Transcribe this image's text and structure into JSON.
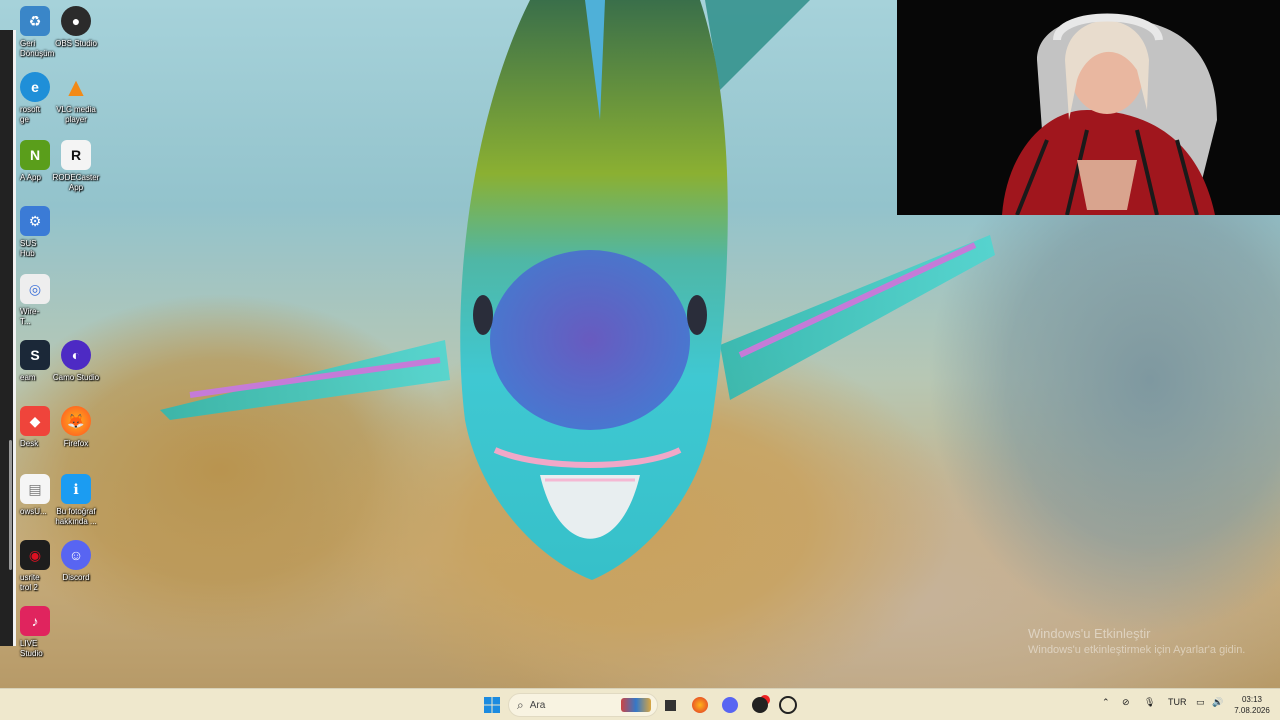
{
  "desktop": {
    "wallpaper": "parrotfish-underwater",
    "icons_col1": [
      {
        "name": "recycle-bin-icon",
        "label": "Geri\nDönüşüm",
        "color": "#3a86c8",
        "glyph": "♻"
      },
      {
        "name": "edge-icon",
        "label": "rosoft\nge",
        "color": "#1f8fd8",
        "glyph": "e"
      },
      {
        "name": "nvidia-icon",
        "label": "A App",
        "color": "#5a9e1b",
        "glyph": "N"
      },
      {
        "name": "asus-icon",
        "label": "SUS\nHub",
        "color": "#3b7bd6",
        "glyph": "⚙"
      },
      {
        "name": "wiretap-icon",
        "label": "Wire-T...",
        "color": "#eeeeee",
        "glyph": "◎"
      },
      {
        "name": "steam-icon",
        "label": "eam",
        "color": "#1b2838",
        "glyph": "S"
      },
      {
        "name": "anydesk-icon",
        "label": "Desk",
        "color": "#ef443b",
        "glyph": "◆"
      },
      {
        "name": "file-icon",
        "label": "owsU...",
        "color": "#f5f5f5",
        "glyph": "▤"
      },
      {
        "name": "focusrite-icon",
        "label": "usrite\ntrol 2",
        "color": "#1d1d1d",
        "glyph": "◉"
      },
      {
        "name": "tiktok-live-icon",
        "label": "LIVE\nStudio",
        "color": "#e0245e",
        "glyph": "♪"
      }
    ],
    "icons_col2": [
      {
        "name": "obs-studio-icon",
        "label": "OBS Studio",
        "color": "#2b2b2b",
        "glyph": "●"
      },
      {
        "name": "vlc-icon",
        "label": "VLC media\nplayer",
        "color": "#f28a17",
        "glyph": "▲"
      },
      {
        "name": "rodecaster-icon",
        "label": "RODECaster\nApp",
        "color": "#f4f4f4",
        "glyph": "R"
      },
      {
        "name": "camo-studio-icon",
        "label": "Camo Studio",
        "color": "#4d2ac4",
        "glyph": "◐"
      },
      {
        "name": "firefox-icon",
        "label": "Firefox",
        "color": "#ff7b1c",
        "glyph": "🦊"
      },
      {
        "name": "spotlight-icon",
        "label": "Bu fotoğraf\nhakkında ...",
        "color": "#1b9cf2",
        "glyph": "ℹ"
      },
      {
        "name": "discord-icon",
        "label": "Discord",
        "color": "#5865f2",
        "glyph": "☺"
      }
    ]
  },
  "watermark": {
    "line1": "Windows'u Etkinleştir",
    "line2": "Windows'u etkinleştirmek için Ayarlar'a gidin."
  },
  "taskbar": {
    "search_placeholder": "Ara",
    "language": "TUR",
    "time": "03:13",
    "date": "7.08.2026"
  }
}
